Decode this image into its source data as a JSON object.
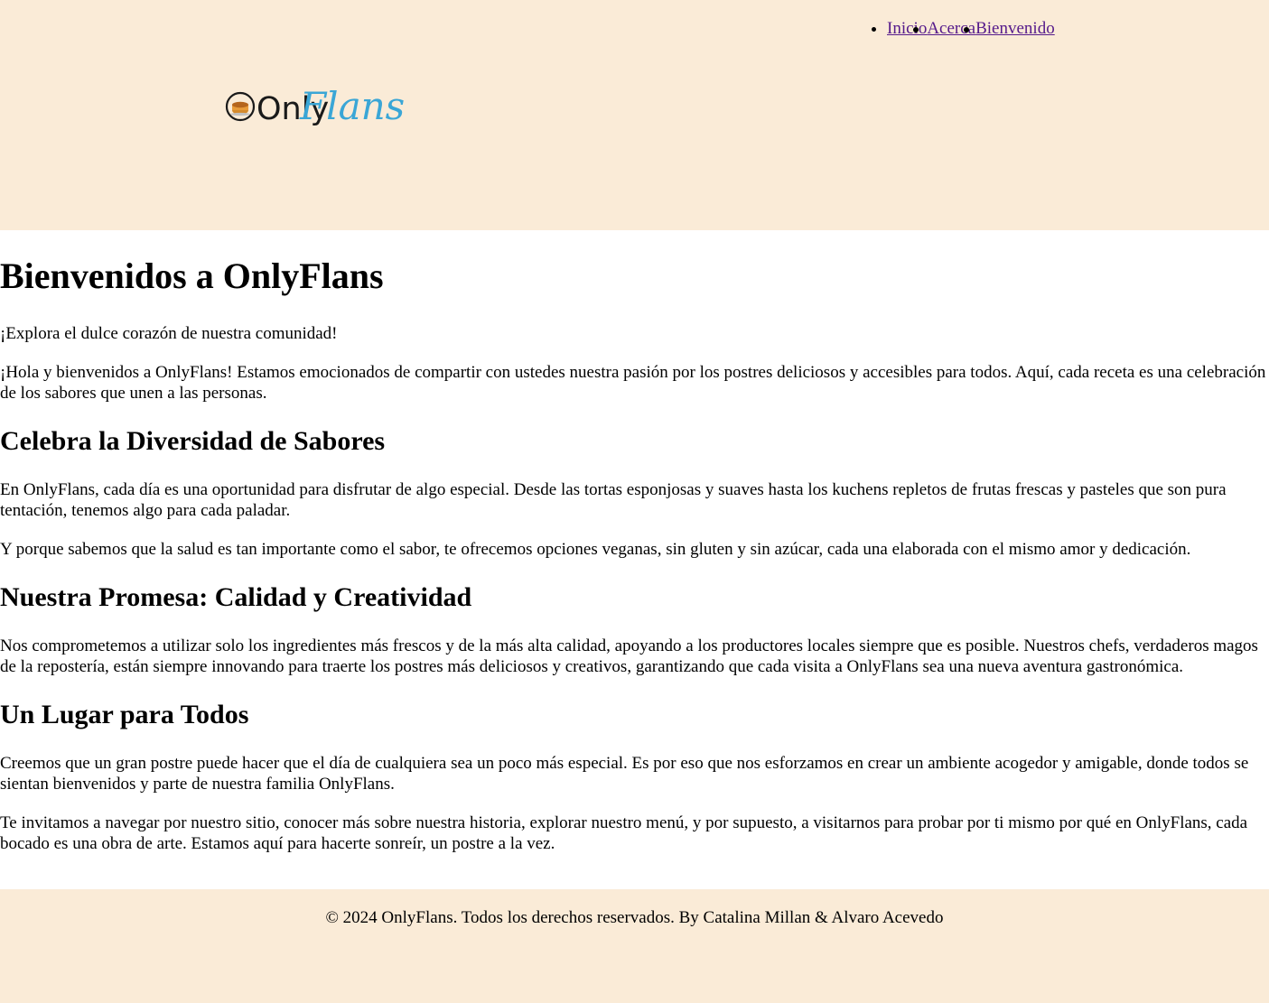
{
  "nav": {
    "items": [
      {
        "label": "Inicio"
      },
      {
        "label": "Acerca"
      },
      {
        "label": "Bienvenido"
      }
    ]
  },
  "logo": {
    "text_part1": "Only",
    "text_part2": "Flans",
    "icon": "flan-icon"
  },
  "main": {
    "title": "Bienvenidos a OnlyFlans",
    "intro": "¡Explora el dulce corazón de nuestra comunidad!",
    "welcome": "¡Hola y bienvenidos a OnlyFlans! Estamos emocionados de compartir con ustedes nuestra pasión por los postres deliciosos y accesibles para todos. Aquí, cada receta es una celebración de los sabores que unen a las personas.",
    "sections": [
      {
        "heading": "Celebra la Diversidad de Sabores",
        "paragraphs": [
          "En OnlyFlans, cada día es una oportunidad para disfrutar de algo especial. Desde las tortas esponjosas y suaves hasta los kuchens repletos de frutas frescas y pasteles que son pura tentación, tenemos algo para cada paladar.",
          "Y porque sabemos que la salud es tan importante como el sabor, te ofrecemos opciones veganas, sin gluten y sin azúcar, cada una elaborada con el mismo amor y dedicación."
        ]
      },
      {
        "heading": "Nuestra Promesa: Calidad y Creatividad",
        "paragraphs": [
          "Nos comprometemos a utilizar solo los ingredientes más frescos y de la más alta calidad, apoyando a los productores locales siempre que es posible. Nuestros chefs, verdaderos magos de la repostería, están siempre innovando para traerte los postres más deliciosos y creativos, garantizando que cada visita a OnlyFlans sea una nueva aventura gastronómica."
        ]
      },
      {
        "heading": "Un Lugar para Todos",
        "paragraphs": [
          "Creemos que un gran postre puede hacer que el día de cualquiera sea un poco más especial. Es por eso que nos esforzamos en crear un ambiente acogedor y amigable, donde todos se sientan bienvenidos y parte de nuestra familia OnlyFlans.",
          "Te invitamos a navegar por nuestro sitio, conocer más sobre nuestra historia, explorar nuestro menú, y por supuesto, a visitarnos para probar por ti mismo por qué en OnlyFlans, cada bocado es una obra de arte. Estamos aquí para hacerte sonreír, un postre a la vez."
        ]
      }
    ]
  },
  "footer": {
    "text": "© 2024 OnlyFlans. Todos los derechos reservados. By Catalina Millan & Alvaro Acevedo"
  },
  "colors": {
    "header_bg": "#faebd7",
    "footer_bg": "#faebd7",
    "logo_blue": "#3aa6d6",
    "link_visited": "#551a8b"
  }
}
